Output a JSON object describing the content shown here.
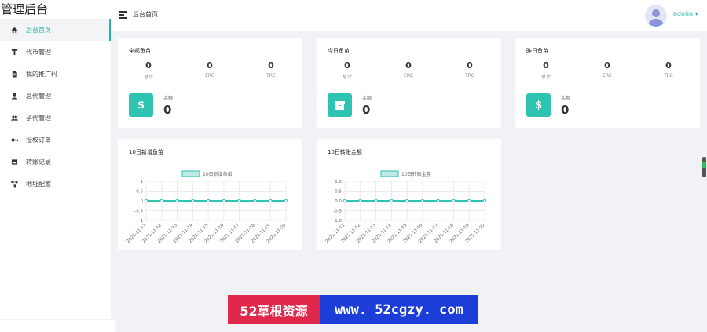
{
  "sidebar": {
    "brand": "管理后台",
    "items": [
      {
        "label": "后台首页",
        "icon": "home-icon",
        "active": true
      },
      {
        "label": "代币管理",
        "icon": "coin-icon",
        "active": false
      },
      {
        "label": "我的推广码",
        "icon": "document-icon",
        "active": false
      },
      {
        "label": "总代管理",
        "icon": "user-icon",
        "active": false
      },
      {
        "label": "子代管理",
        "icon": "users-icon",
        "active": false
      },
      {
        "label": "授权订单",
        "icon": "key-icon",
        "active": false
      },
      {
        "label": "转账记录",
        "icon": "card-icon",
        "active": false
      },
      {
        "label": "地址配置",
        "icon": "network-icon",
        "active": false
      }
    ]
  },
  "header": {
    "menu_icon": "menu-icon",
    "breadcrumb": "后台首页",
    "user": "admin ▾",
    "avatar_icon": "avatar-icon"
  },
  "stats": [
    {
      "title": "全部鱼苗",
      "cells": [
        {
          "value": "0",
          "label": "总计"
        },
        {
          "value": "0",
          "label": "ERC"
        },
        {
          "value": "0",
          "label": "TRC"
        }
      ],
      "icon": "dollar-icon",
      "balance_label": "余额",
      "balance": "0"
    },
    {
      "title": "今日鱼苗",
      "cells": [
        {
          "value": "0",
          "label": "总计"
        },
        {
          "value": "0",
          "label": "ERC"
        },
        {
          "value": "0",
          "label": "TRC"
        }
      ],
      "icon": "archive-icon",
      "balance_label": "余额",
      "balance": "0"
    },
    {
      "title": "昨日鱼苗",
      "cells": [
        {
          "value": "0",
          "label": "总计"
        },
        {
          "value": "0",
          "label": "ERC"
        },
        {
          "value": "0",
          "label": "TRC"
        }
      ],
      "icon": "dollar-icon",
      "balance_label": "余额",
      "balance": "0"
    }
  ],
  "chart_data": [
    {
      "type": "line",
      "title": "10日新增鱼苗",
      "legend": "10日新增鱼苗",
      "legend_position": "top-center",
      "categories": [
        "2021-11-11",
        "2021-11-12",
        "2021-11-13",
        "2021-11-14",
        "2021-11-15",
        "2021-11-16",
        "2021-11-17",
        "2021-11-18",
        "2021-11-19",
        "2021-11-20"
      ],
      "series": [
        {
          "name": "10日新增鱼苗",
          "values": [
            0,
            0,
            0,
            0,
            0,
            0,
            0,
            0,
            0,
            0
          ]
        }
      ],
      "ylim": [
        -1,
        1
      ],
      "yticks": [
        "1",
        "0.5",
        "0",
        "-0.5",
        "-1"
      ],
      "ytick_values": [
        1,
        0.5,
        0,
        -0.5,
        -1
      ],
      "grid": true,
      "color": "#2fc3b2"
    },
    {
      "type": "line",
      "title": "10日转账金额",
      "legend": "10日转账金额",
      "legend_position": "top-center",
      "categories": [
        "2021-11-11",
        "2021-11-12",
        "2021-11-13",
        "2021-11-14",
        "2021-11-15",
        "2021-11-16",
        "2021-11-17",
        "2021-11-18",
        "2021-11-19",
        "2021-11-20"
      ],
      "series": [
        {
          "name": "10日转账金额",
          "values": [
            0,
            0,
            0,
            0,
            0,
            0,
            0,
            0,
            0,
            0
          ]
        }
      ],
      "ylim": [
        -1,
        1
      ],
      "yticks": [
        "1.0",
        "0.5",
        "0.0",
        "-0.5",
        "-1.0"
      ],
      "ytick_values": [
        1,
        0.5,
        0,
        -0.5,
        -1
      ],
      "grid": true,
      "color": "#2fc3b2"
    }
  ],
  "watermark": {
    "left": "52草根资源",
    "right": "www. 52cgzy. com"
  }
}
